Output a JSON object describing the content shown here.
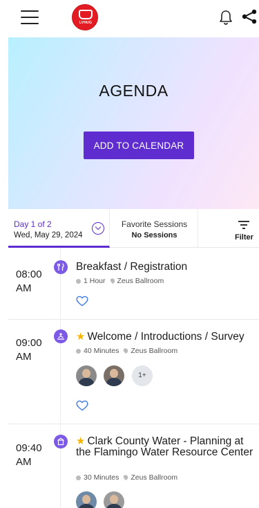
{
  "topbar": {
    "logo_text": "LVHUG",
    "icons": [
      "hamburger-icon",
      "bell-icon",
      "share-icon"
    ]
  },
  "banner": {
    "title": "AGENDA",
    "button_label": "ADD TO CALENDAR"
  },
  "tabs": {
    "day_label": "Day 1 of 2",
    "day_date": "Wed, May 29, 2024",
    "favorites_label": "Favorite Sessions",
    "favorites_value": "No Sessions",
    "filter_label": "Filter"
  },
  "sessions": [
    {
      "time_hm": "08:00",
      "time_ampm": "AM",
      "title": "Breakfast / Registration",
      "starred": false,
      "duration": "1 Hour",
      "room": "Zeus Ballroom"
    },
    {
      "time_hm": "09:00",
      "time_ampm": "AM",
      "title": "Welcome / Introductions / Survey",
      "starred": true,
      "duration": "40 Minutes",
      "room": "Zeus Ballroom",
      "more_speakers": "1+"
    },
    {
      "time_hm": "09:40",
      "time_ampm": "AM",
      "title": "Clark County Water - Planning at the Flamingo Water Resource Center",
      "starred": true,
      "duration": "30 Minutes",
      "room": "Zeus Ballroom"
    }
  ],
  "colors": {
    "accent": "#5e2ccf",
    "icon_bg": "#7d5ae6",
    "star": "#f7b500",
    "logo_red": "#e31c23"
  }
}
